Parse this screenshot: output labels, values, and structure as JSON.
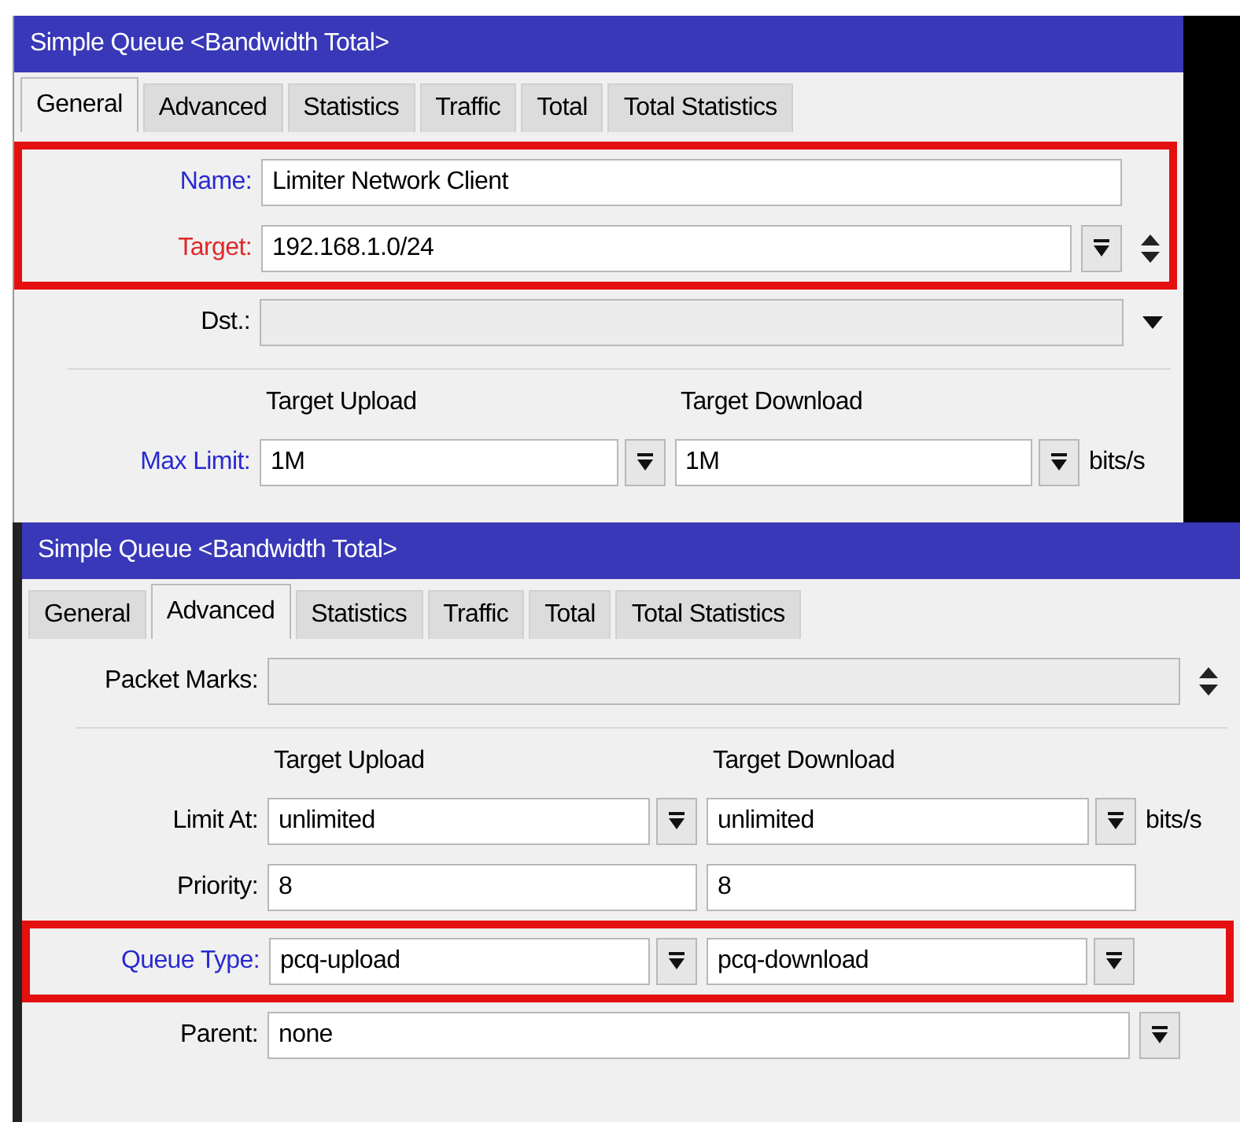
{
  "windows": [
    {
      "title": "Simple Queue <Bandwidth Total>",
      "tabs": [
        {
          "label": "General",
          "selected": true
        },
        {
          "label": "Advanced",
          "selected": false
        },
        {
          "label": "Statistics",
          "selected": false
        },
        {
          "label": "Traffic",
          "selected": false
        },
        {
          "label": "Total",
          "selected": false
        },
        {
          "label": "Total Statistics",
          "selected": false
        }
      ],
      "rows": [
        {
          "kind": "text",
          "label": "Name:",
          "color": "#2a2ad0",
          "value": "Limiter Network Client",
          "highlighted": true,
          "disabled": false
        },
        {
          "kind": "text",
          "label": "Target:",
          "color": "#e02828",
          "value": "192.168.1.0/24",
          "highlighted": true,
          "disabled": false,
          "dropdown": true,
          "spinner": true
        },
        {
          "kind": "text",
          "label": "Dst.:",
          "color": "#000000",
          "highlighted": false,
          "disabled": true,
          "caret": true
        },
        {
          "kind": "headers",
          "columns": [
            "Target Upload",
            "Target Download"
          ]
        },
        {
          "kind": "pair",
          "label": "Max Limit:",
          "color": "#2a2ad0",
          "values": [
            "1M",
            "1M"
          ],
          "dropdown": true,
          "unit": "bits/s",
          "highlighted": false
        }
      ]
    },
    {
      "title": "Simple Queue <Bandwidth Total>",
      "tabs": [
        {
          "label": "General",
          "selected": false
        },
        {
          "label": "Advanced",
          "selected": true
        },
        {
          "label": "Statistics",
          "selected": false
        },
        {
          "label": "Traffic",
          "selected": false
        },
        {
          "label": "Total",
          "selected": false
        },
        {
          "label": "Total Statistics",
          "selected": false
        }
      ],
      "rows": [
        {
          "kind": "text",
          "label": "Packet Marks:",
          "color": "#000000",
          "highlighted": false,
          "disabled": true,
          "spinner": true
        },
        {
          "kind": "headers",
          "columns": [
            "Target Upload",
            "Target Download"
          ]
        },
        {
          "kind": "pair",
          "label": "Limit At:",
          "color": "#000000",
          "values": [
            "unlimited",
            "unlimited"
          ],
          "dropdown": true,
          "unit": "bits/s",
          "highlighted": false
        },
        {
          "kind": "pair",
          "label": "Priority:",
          "color": "#000000",
          "values": [
            "8",
            "8"
          ],
          "dropdown": false,
          "highlighted": false
        },
        {
          "kind": "pair",
          "label": "Queue Type:",
          "color": "#2a2ad0",
          "values": [
            "pcq-upload",
            "pcq-download"
          ],
          "dropdown": true,
          "highlighted": true
        },
        {
          "kind": "text",
          "label": "Parent:",
          "color": "#000000",
          "value": "none",
          "highlighted": false,
          "disabled": false,
          "dropdown": true
        }
      ]
    }
  ]
}
